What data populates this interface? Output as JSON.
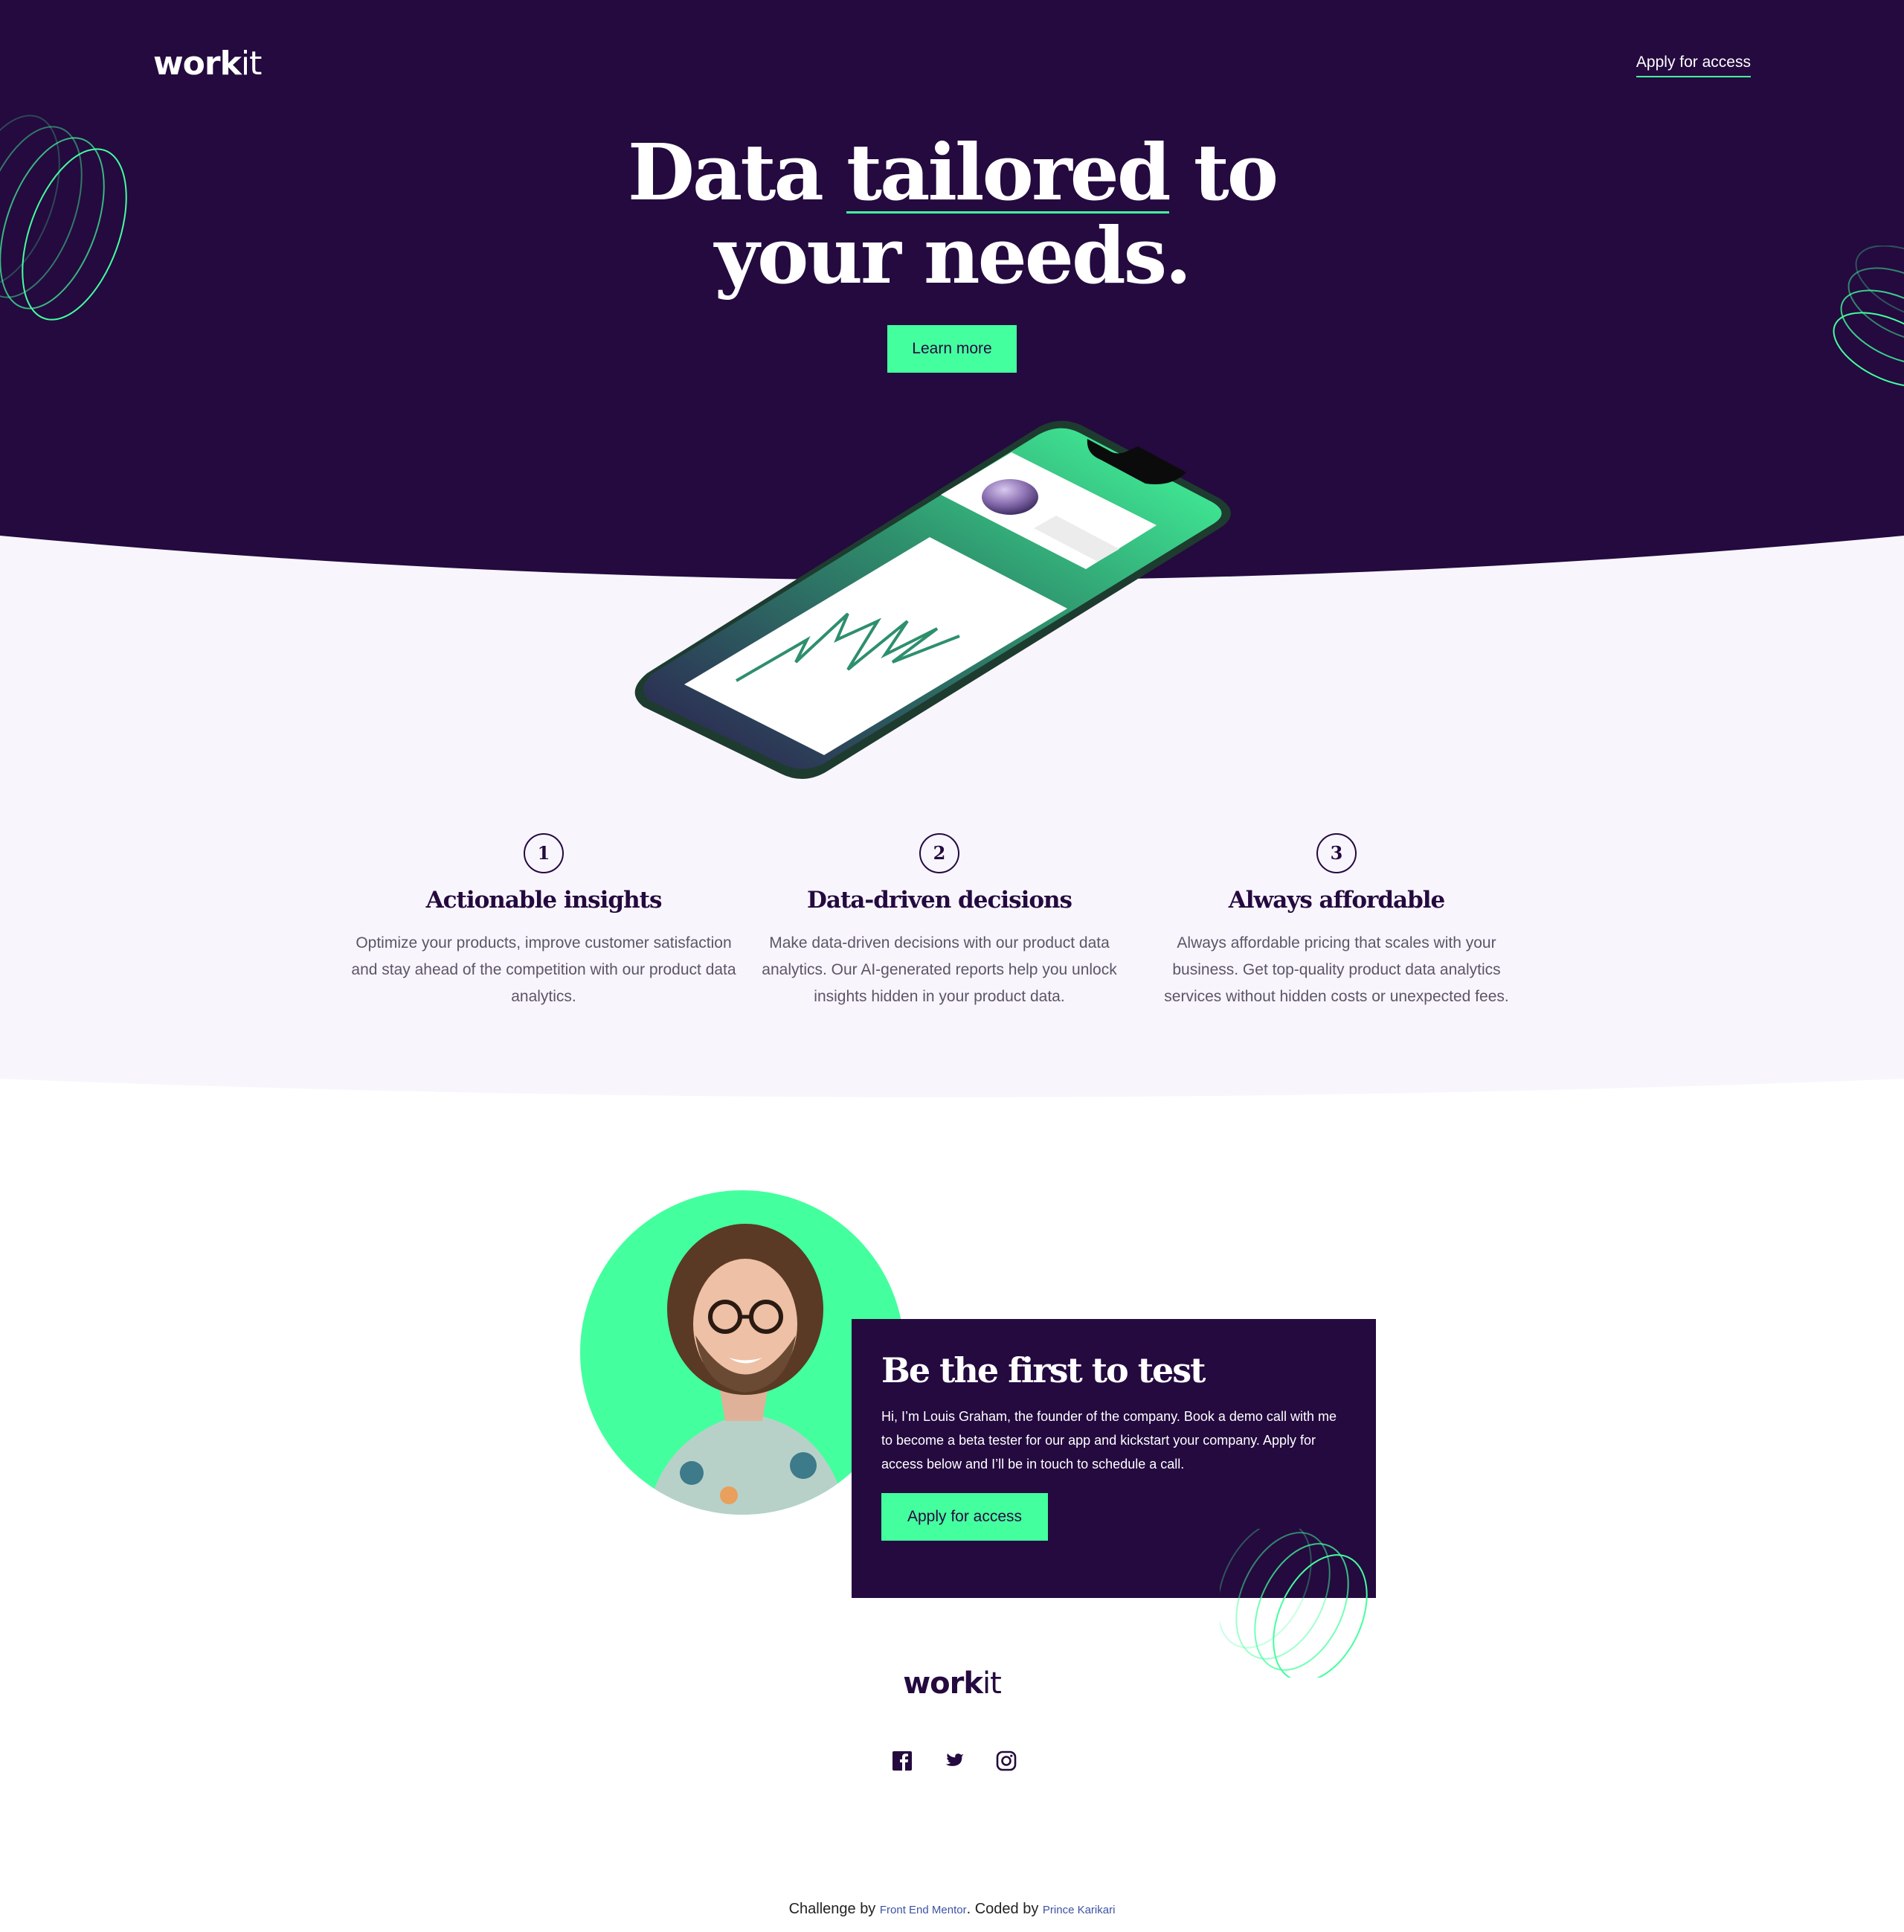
{
  "brand": {
    "logo_bold": "work",
    "logo_light": "it"
  },
  "nav": {
    "apply_label": "Apply for access"
  },
  "hero": {
    "title_line1_a": "Data ",
    "title_line1_b": "tailored",
    "title_line1_c": " to",
    "title_line2": "your needs.",
    "cta_label": "Learn more"
  },
  "features": [
    {
      "number": "1",
      "title": "Actionable insights",
      "text": "Optimize your products, improve customer satisfaction and stay ahead of the competition with our product data analytics."
    },
    {
      "number": "2",
      "title": "Data-driven decisions",
      "text": "Make data-driven decisions with our product data analytics. Our AI-generated reports help you unlock insights hidden in your product data."
    },
    {
      "number": "3",
      "title": "Always affordable",
      "text": "Always affordable pricing that scales with your business. Get top-quality product data analytics services without hidden costs or unexpected fees."
    }
  ],
  "founder": {
    "title": "Be the first to test",
    "text": "Hi, I’m Louis Graham, the founder of the company. Book a demo call with me to become a beta tester for our app and kickstart your company. Apply for access below and I’ll be in touch to schedule a call.",
    "cta_label": "Apply for access"
  },
  "footer": {
    "logo_bold": "work",
    "logo_light": "it",
    "socials": [
      "facebook-icon",
      "twitter-icon",
      "instagram-icon"
    ],
    "attribution_prefix": "Challenge by ",
    "attribution_link1": "Front End Mentor",
    "attribution_middle": ". Coded by ",
    "attribution_link2": "Prince Karikari"
  },
  "colors": {
    "dark_purple": "#240a3f",
    "mint": "#44ff9e",
    "light_bg": "#f8f5fd"
  }
}
